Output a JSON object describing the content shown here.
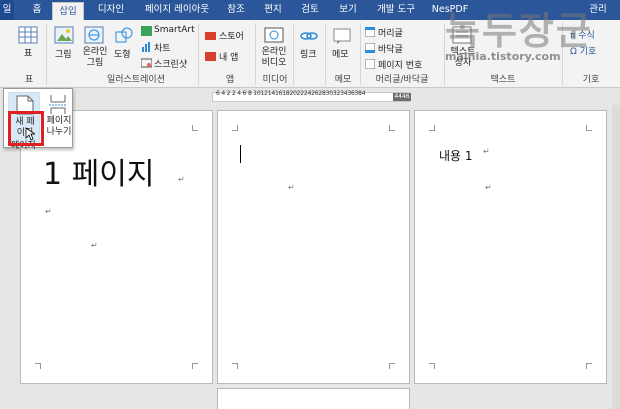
{
  "tabs": {
    "file": "일",
    "home": "홈",
    "insert": "삽입",
    "design": "디자인",
    "layout": "페이지 레이아웃",
    "references": "참조",
    "mailings": "편지",
    "review": "검토",
    "view": "보기",
    "developer": "개발 도구",
    "nespdf": "NesPDF",
    "extra": "관리"
  },
  "ribbon": {
    "table_btn": "표",
    "table_group": "표",
    "picture": "그림",
    "online_picture": "온라인\n그림",
    "shapes": "도형",
    "smartart": "SmartArt",
    "chart": "차트",
    "screenshot": "스크린샷",
    "illustrations_group": "일러스트레이션",
    "store": "스토어",
    "my_apps": "내 앱",
    "apps_group": "앱",
    "online_video": "온라인\n비디오",
    "media_group": "미디어",
    "link": "링크",
    "memo": "메모",
    "memo_group": "메모",
    "header": "머리글",
    "footer": "바닥글",
    "page_number": "페이지 번호",
    "header_footer_group": "머리글/바닥글",
    "textbox": "텍스트\n상자",
    "text_group": "텍스트",
    "equation": "π 수식",
    "symbol": "Ω 기호",
    "symbols_group": "기호"
  },
  "popup": {
    "new_page": "새 페\n이지",
    "page_break": "페이지\n나누기",
    "group_label": "페이지"
  },
  "watermark": {
    "title": "녹두장군",
    "url": "mainia.tistory.com"
  },
  "ruler": {
    "numbers": "6 4 2  2 4 6 8 1012141618202224262830323436384",
    "end_value": "4446"
  },
  "pages": {
    "page1_title": "1 페이지",
    "page3_text": "내용 1"
  },
  "colors": {
    "ribbon_tab_bg": "#2b579a",
    "highlight": "#e02020"
  }
}
